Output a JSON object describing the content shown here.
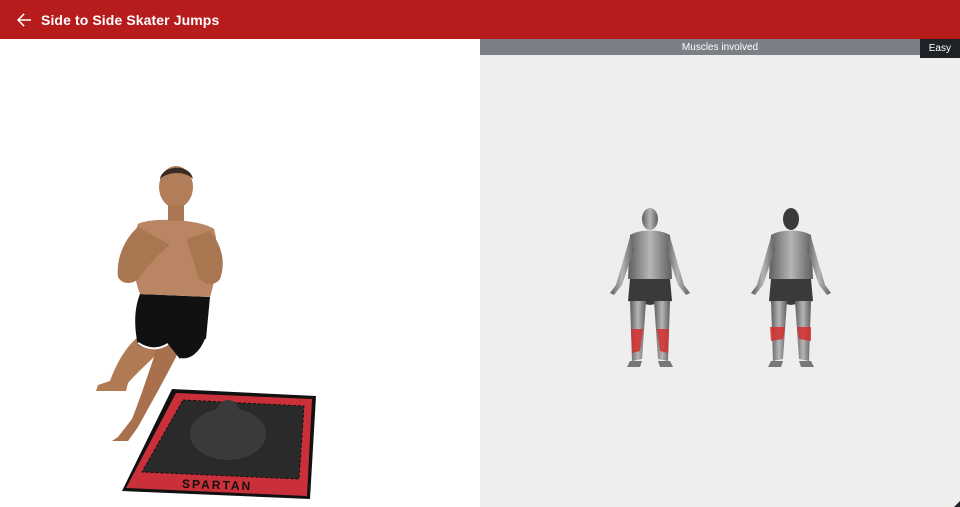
{
  "app_bar": {
    "title": "Side to Side Skater Jumps",
    "back_icon": "arrow-back-icon",
    "background": "#b71c1c"
  },
  "exercise_panel": {
    "mat_text": "SPARTAN"
  },
  "muscles_panel": {
    "header": "Muscles involved",
    "difficulty": "Easy",
    "highlight_color": "#d32f2f"
  }
}
